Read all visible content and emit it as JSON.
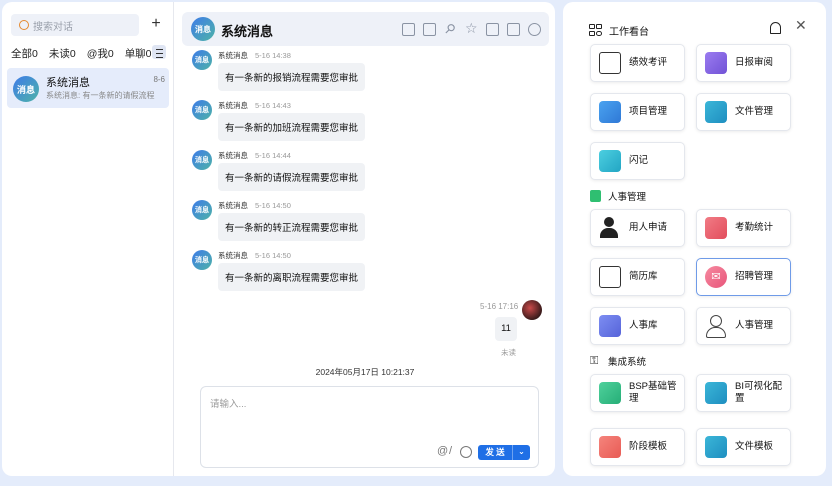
{
  "sidebar": {
    "search_placeholder": "搜索对话",
    "add_label": "+",
    "filters": [
      "全部0",
      "未读0",
      "@我0",
      "单聊0"
    ],
    "conversation": {
      "avatar_text": "消息",
      "name": "系统消息",
      "preview": "系统消息: 有一条新的请假流程",
      "time": "8-6"
    }
  },
  "chat": {
    "title": "系统消息",
    "avatar_text": "消息",
    "messages": [
      {
        "sender": "系统消息",
        "time": "5-16 14:38",
        "text": "有一条新的报销流程需要您审批"
      },
      {
        "sender": "系统消息",
        "time": "5-16 14:43",
        "text": "有一条新的加班流程需要您审批"
      },
      {
        "sender": "系统消息",
        "time": "5-16 14:44",
        "text": "有一条新的请假流程需要您审批"
      },
      {
        "sender": "系统消息",
        "time": "5-16 14:50",
        "text": "有一条新的转正流程需要您审批"
      },
      {
        "sender": "系统消息",
        "time": "5-16 14:50",
        "text": "有一条新的离职流程需要您审批"
      }
    ],
    "my_message": {
      "time": "5-16 17:16",
      "text": "11",
      "status": "未读"
    },
    "timestamp": "2024年05月17日 10:21:37",
    "input_placeholder": "请输入...",
    "at_symbol": "@",
    "slash_symbol": "/",
    "send_label": "发 送"
  },
  "workbench": {
    "title": "工作看台",
    "sections": [
      {
        "title": "",
        "items": [
          "绩效考评",
          "日报审阅",
          "项目管理",
          "文件管理",
          "闪记"
        ]
      },
      {
        "title": "人事管理",
        "items": [
          "用人申请",
          "考勤统计",
          "简历库",
          "招聘管理",
          "人事库",
          "人事管理"
        ]
      },
      {
        "title": "集成系统",
        "items": [
          "BSP基础管理",
          "BI可视化配置",
          "阶段模板",
          "文件模板"
        ]
      }
    ],
    "colors": {
      "accent": "#1f6fe6",
      "active_border": "#6f9be8"
    }
  }
}
